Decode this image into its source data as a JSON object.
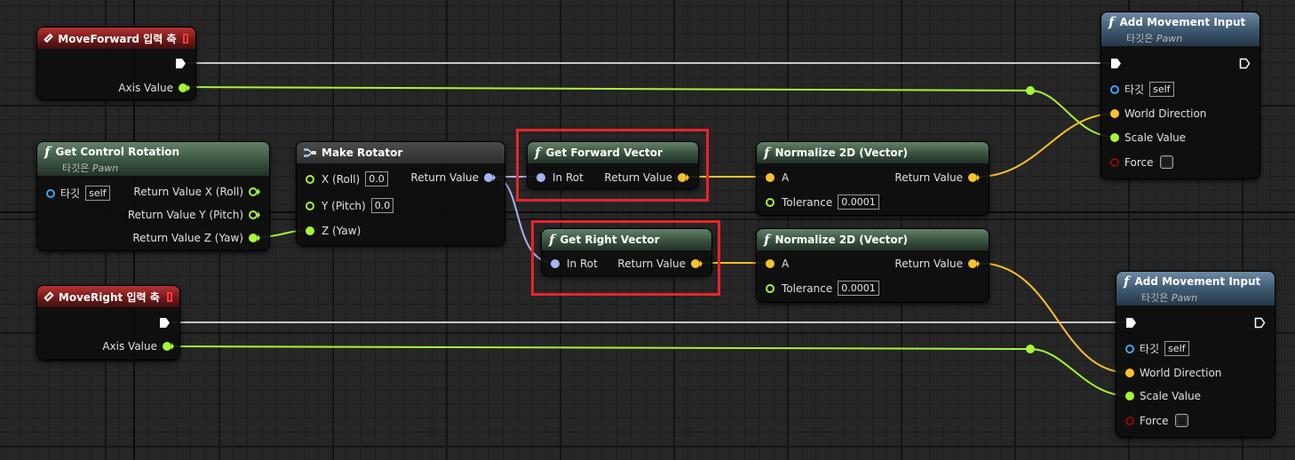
{
  "colors": {
    "exec_wire": "#d8d8d8",
    "float_wire": "#a6f53b",
    "vector_wire": "#f7c12a",
    "rotator_wire": "#a9b3f5",
    "highlight": "#e8242a"
  },
  "nodes": {
    "move_forward": {
      "title": "MoveForward 입력 축",
      "axis_value": "Axis Value"
    },
    "move_right": {
      "title": "MoveRight 입력 축",
      "axis_value": "Axis Value"
    },
    "get_control_rotation": {
      "title": "Get Control Rotation",
      "subtitle_prefix": "타깃은",
      "subtitle_class": "Pawn",
      "target_label": "타깃",
      "target_value": "self",
      "ret_x": "Return Value X (Roll)",
      "ret_y": "Return Value Y (Pitch)",
      "ret_z": "Return Value Z (Yaw)"
    },
    "make_rotator": {
      "title": "Make Rotator",
      "x_label": "X (Roll)",
      "x_value": "0.0",
      "y_label": "Y (Pitch)",
      "y_value": "0.0",
      "z_label": "Z (Yaw)",
      "ret": "Return Value"
    },
    "get_forward_vector": {
      "title": "Get Forward Vector",
      "in_rot": "In Rot",
      "ret": "Return Value"
    },
    "get_right_vector": {
      "title": "Get Right Vector",
      "in_rot": "In Rot",
      "ret": "Return Value"
    },
    "normalize_1": {
      "title": "Normalize 2D (Vector)",
      "a": "A",
      "ret": "Return Value",
      "tolerance_label": "Tolerance",
      "tolerance_value": "0.0001"
    },
    "normalize_2": {
      "title": "Normalize 2D (Vector)",
      "a": "A",
      "ret": "Return Value",
      "tolerance_label": "Tolerance",
      "tolerance_value": "0.0001"
    },
    "add_movement_1": {
      "title": "Add Movement Input",
      "subtitle_prefix": "타깃은",
      "subtitle_class": "Pawn",
      "target_label": "타깃",
      "target_value": "self",
      "world_direction": "World Direction",
      "scale_value": "Scale Value",
      "force": "Force"
    },
    "add_movement_2": {
      "title": "Add Movement Input",
      "subtitle_prefix": "타깃은",
      "subtitle_class": "Pawn",
      "target_label": "타깃",
      "target_value": "self",
      "world_direction": "World Direction",
      "scale_value": "Scale Value",
      "force": "Force"
    }
  }
}
